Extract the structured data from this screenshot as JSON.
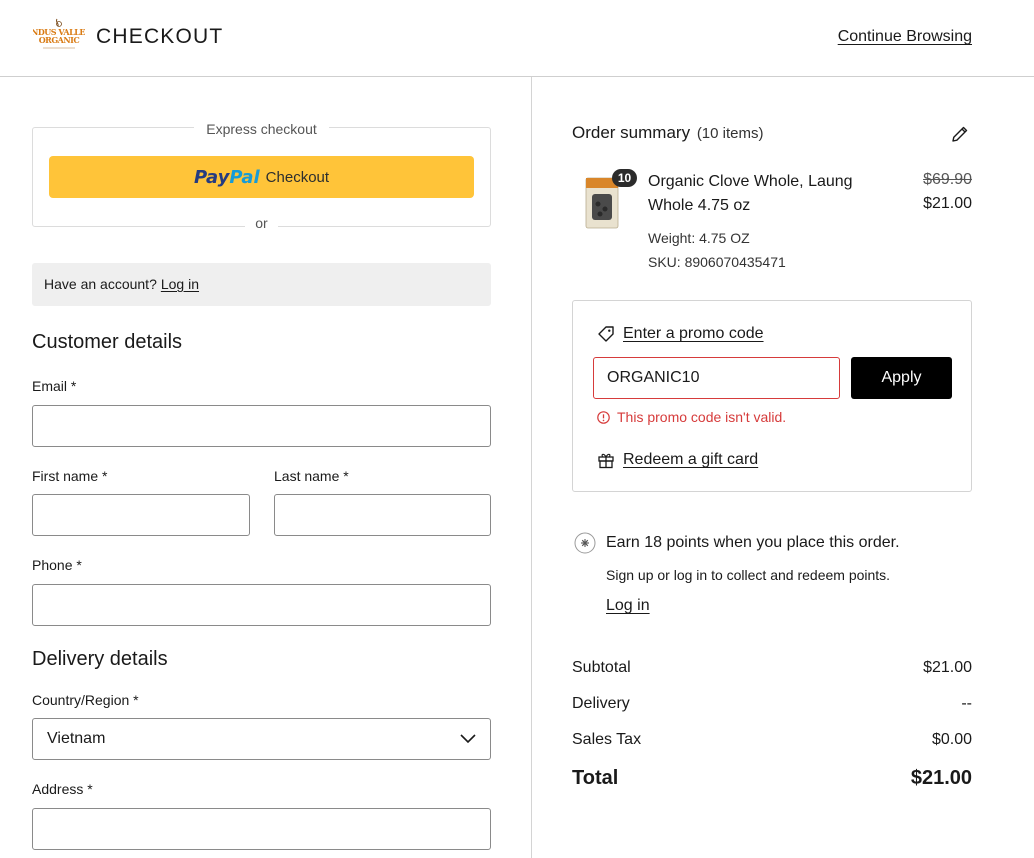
{
  "header": {
    "brand_line1": "INDUS VALLEY",
    "brand_line2": "ORGANIC",
    "title": "CHECKOUT",
    "continue_label": "Continue Browsing"
  },
  "express": {
    "label": "Express checkout",
    "paypal_pay": "Pay",
    "paypal_pal": "Pal",
    "paypal_checkout": "Checkout",
    "or_label": "or"
  },
  "account": {
    "prompt": "Have an account?",
    "login_label": "Log in"
  },
  "customer": {
    "title": "Customer details",
    "email_label": "Email *",
    "email_value": "",
    "first_name_label": "First name *",
    "first_name_value": "",
    "last_name_label": "Last name *",
    "last_name_value": "",
    "phone_label": "Phone *",
    "phone_value": ""
  },
  "delivery": {
    "title": "Delivery details",
    "country_label": "Country/Region *",
    "country_value": "Vietnam",
    "address_label": "Address *",
    "address_value": ""
  },
  "summary": {
    "title": "Order summary",
    "item_count": "(10 items)",
    "product": {
      "quantity": "10",
      "name": "Organic Clove Whole, Laung Whole 4.75 oz",
      "price_original": "$69.90",
      "price_current": "$21.00",
      "weight": "Weight: 4.75 OZ",
      "sku": "SKU: 8906070435471"
    },
    "promo": {
      "link_label": "Enter a promo code",
      "input_value": "ORGANIC10",
      "apply_label": "Apply",
      "error_text": "This promo code isn't valid.",
      "gift_label": "Redeem a gift card"
    },
    "points": {
      "title": "Earn 18 points when you place this order.",
      "subtitle": "Sign up or log in to collect and redeem points.",
      "login_label": "Log in"
    },
    "totals": {
      "subtotal_label": "Subtotal",
      "subtotal_value": "$21.00",
      "delivery_label": "Delivery",
      "delivery_value": "--",
      "tax_label": "Sales Tax",
      "tax_value": "$0.00",
      "total_label": "Total",
      "total_value": "$21.00"
    }
  },
  "colors": {
    "paypal_yellow": "#ffc439",
    "paypal_dark_blue": "#253b80",
    "paypal_light_blue": "#179bd7",
    "error_red": "#d63b3b",
    "button_black": "#000000",
    "brand_orange": "#d97a12"
  },
  "icons": {
    "edit": "pencil-icon",
    "promo": "tag-icon",
    "gift": "gift-icon",
    "error": "alert-circle-icon",
    "points": "star-burst-icon",
    "dropdown": "chevron-down-icon"
  }
}
